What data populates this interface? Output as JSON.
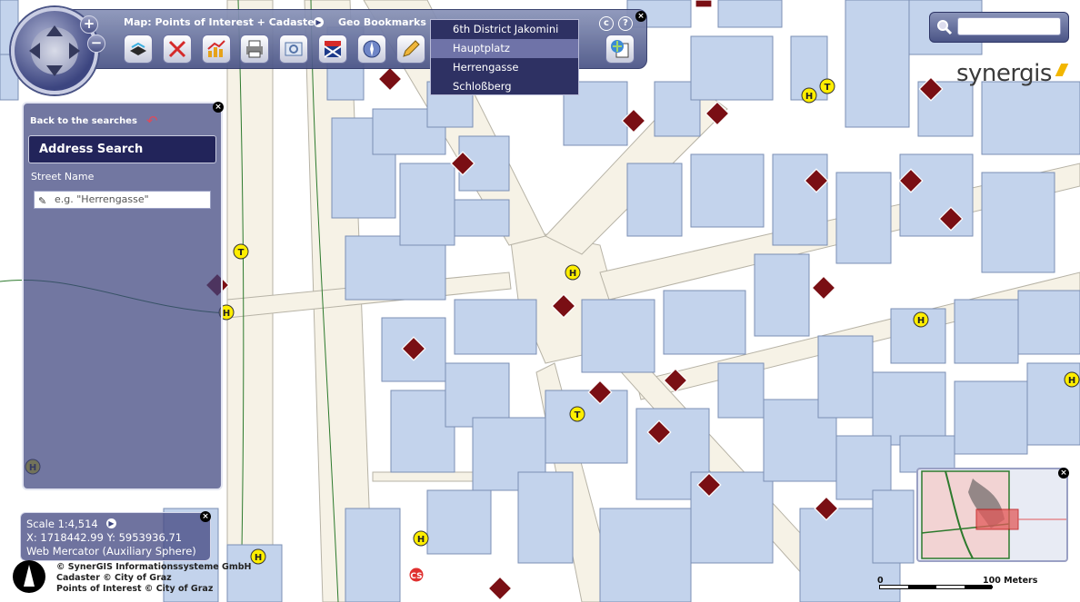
{
  "toolbar": {
    "map_title": "Map: Points of Interest + Cadaster",
    "bookmarks_title": "Geo Bookmarks",
    "tools": [
      "layers-icon",
      "clear-icon",
      "chart-icon",
      "print-icon",
      "measure-icon",
      "language-flag-icon",
      "compass-icon",
      "edit-pencil-icon",
      "globe-doc-icon"
    ]
  },
  "bookmarks": {
    "items": [
      {
        "label": "6th District Jakomini",
        "active": false
      },
      {
        "label": "Hauptplatz",
        "active": true
      },
      {
        "label": "Herrengasse",
        "active": false
      },
      {
        "label": "Schloßberg",
        "active": false
      }
    ]
  },
  "search": {
    "placeholder": ""
  },
  "brand": {
    "logo_text": "synergis"
  },
  "address_panel": {
    "back_label": "Back to the searches",
    "title": "Address Search",
    "field_label": "Street Name",
    "input_placeholder": "e.g. \"Herrengasse\""
  },
  "coords": {
    "scale": "Scale 1:4,514",
    "xy": "X: 1718442.99 Y: 5953936.71",
    "projection": "Web Mercator (Auxiliary Sphere)"
  },
  "copyright": {
    "line1": "© SynerGIS Informationssysteme GmbH",
    "line2": "Cadaster © City of Graz",
    "line3": "Points of Interest © City of Graz"
  },
  "scale_bar": {
    "start": "0",
    "end": "100 Meters"
  },
  "colors": {
    "accent": "#4a5486",
    "panel": "#3c427d",
    "building": "#c3d3ec",
    "building_stroke": "#7b8fb4",
    "poi": "#7a0f14",
    "marker_yellow": "#ffee00"
  }
}
